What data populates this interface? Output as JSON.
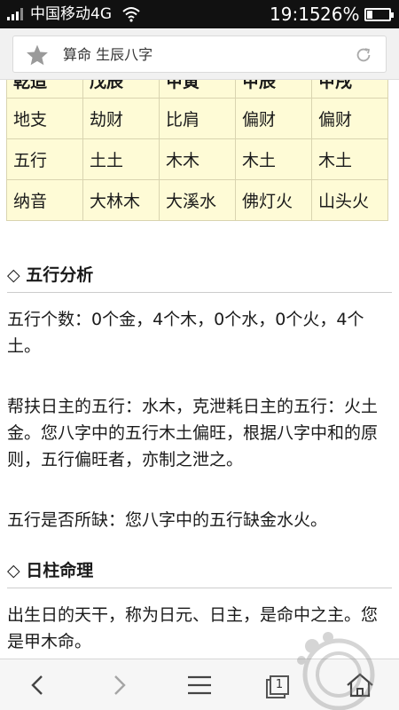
{
  "status_bar": {
    "carrier": "中国移动4G",
    "time": "19:15",
    "battery_percent": "26%",
    "battery_level": 0.26,
    "icons": [
      "signal-icon",
      "wifi-icon",
      "battery-icon"
    ]
  },
  "address_bar": {
    "title": "算命 生辰八字",
    "icons": [
      "star-icon",
      "refresh-icon"
    ]
  },
  "table": {
    "header": [
      "乾造",
      "戊辰",
      "甲寅",
      "甲辰",
      "甲戌"
    ],
    "rows": [
      [
        "地支",
        "劫财",
        "比肩",
        "偏财",
        "偏财"
      ],
      [
        "五行",
        "土土",
        "木木",
        "木土",
        "木土"
      ],
      [
        "纳音",
        "大林木",
        "大溪水",
        "佛灯火",
        "山头火"
      ]
    ]
  },
  "sections": [
    {
      "title": "五行分析",
      "paragraphs": [
        "五行个数：0个金，4个木，0个水，0个火，4个土。",
        "帮扶日主的五行：水木，克泄耗日主的五行：火土金。您八字中的五行木土偏旺，根据八字中和的原则，五行偏旺者，亦制之泄之。",
        "五行是否所缺：您八字中的五行缺金水火。"
      ]
    },
    {
      "title": "日柱命理",
      "paragraphs": [
        "出生日的天干，称为日元、日主，是命中之主。您是甲木命。"
      ]
    }
  ],
  "section_marker": "◇",
  "toolbar": {
    "tab_count": "1",
    "icons": [
      "back-icon",
      "forward-icon",
      "menu-icon",
      "tabs-icon",
      "home-icon"
    ]
  },
  "colors": {
    "table_bg": "#fefbd6",
    "status_bar_bg": "#111111"
  }
}
